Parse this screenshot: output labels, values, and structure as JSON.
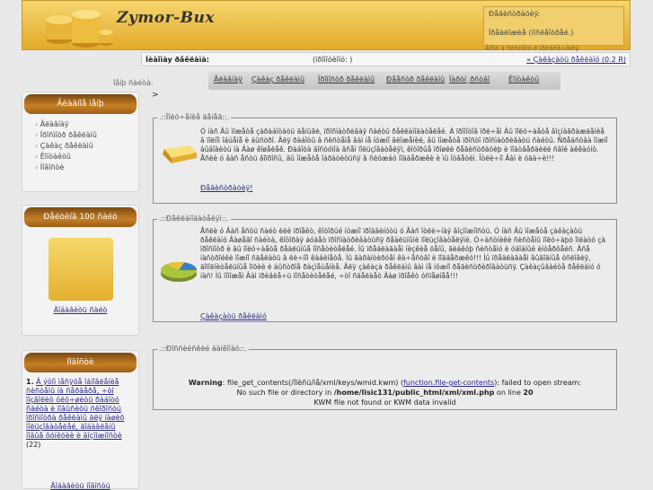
{
  "header": {
    "logo": "Zymor-Bux",
    "register_title": "Ðåãèñòðàöèÿ:",
    "register_line2": "Ïðåäëîæèå (ïîñëåîòðåé.)",
    "register_sub": "Âõîä â ñèñòåìó è ïðèâëå÷åíèÿ"
  },
  "infobar": {
    "label": "Íèàîìày ðåêëàìà:",
    "middle": "(ïðîìîòèîíó: )",
    "right_link": "» Çàêàçàòü ðåêëàìó (0.2 R)"
  },
  "topnav": {
    "label": "Ìåíþ ñàéòà:",
    "items": [
      "Ãëàâíàÿ",
      "Çàêàç ðåêëàìû",
      "Ïðîìîñòð ðåêëàìû",
      "Ðååñòð ðåêëàìû",
      "Ïàðòí¸ðñòâî",
      "Êîíòàêòû"
    ],
    "arrow": ">"
  },
  "menu": {
    "title": "Ãëàâíîå ìåíþ",
    "items": [
      "Ãëàâíàÿ",
      "Ïðîñìîòð ðåêëàìû",
      "Çàêàç ðåêëàìû",
      "Êîíòàêòû",
      "Íîâîñòè"
    ]
  },
  "top100": {
    "title": "Ðåéòèíã 100 ñàéò",
    "link": "Äîáàâèòü ñàéò"
  },
  "news": {
    "title": "Íîâîñòè",
    "item_num": "1.",
    "item_text": "Â ýòîì ìåñÿöå îáíîâëåíèå ñèñòåìû íà ñåðâåðå, ÷òî ïîçâîëèò óëó÷øèòü ðàáîòó ñàéòà è ïîâûñèòü ñêîðîñòü ïðîñìîòðà ðåêëàìû äëÿ íàøèõ ïîëüçîâàòåëåé, äîáàâëåíû íîâûå ôóíêöèè è âîçìîæíîñòè",
    "item_count": "(22)",
    "more": "Äîáàâèòü íîâîñòü"
  },
  "section1": {
    "legend": ".::Ïîëó÷åíèå äåíåã::.",
    "text": "Ó íàñ Âû ìîæåòå çàðàáîòàòü äåíüãè, ïðîñìàòðèâàÿ ñàéòû ðåêëàìîäàòåëåé. À ïðîìîòîâ ïðè÷åì Âû ïîëó÷àåòå âîçíàãðàæäåíèå â ïîëíîì îáúåìå è áûñòðî. Äëÿ ðàáîòû â ñèñòåìå âàì íå íóæíî âëîæåíèé, âû ìîæåòå ïðîñòî ïðîñìàòðèâàòü ñàéòû. Ñðåäñòâà ìîæíî âûâîäèòü íà Âàø êîøåëåê. Ðàáîòà äîñòóïíà âñåì ïîëüçîâàòåëÿì, êîòîðûå ïðîøëè ðåãèñòðàöèþ è ïîäòâåðäèëè ñâîé àêêàóíò. Åñëè ó âàñ åñòü âîïðîñû, âû ìîæåòå îáðàòèòüñÿ â ñëóæáó ïîääåðæêè è ìû îòâåòèì. Îòëè÷íî Âàì è óäà÷è!!!",
    "link": "Ðåãèñòðàöèÿ!"
  },
  "section2": {
    "legend": ".::Ðåêëàìîäàòåëÿì::.",
    "text": "Åñëè ó Âàñ åñòü ñàéò èëè ïðîåêò, êîòîðûé íóæíî ïðîäâèíóòü ó Âàñ îòëè÷íàÿ âîçìîæíîñòü. Ó íàñ Âû ìîæåòå çàêàçàòü ðåêëàìó Âàøåãî ñàéòà, êîòîðàÿ áóäåò ïðîñìàòðèâàòüñÿ ðåàëüíûìè ïîëüçîâàòåëÿìè. Ó÷àñòíèêè ñèñòåìû ïîëó÷àþò îïëàòó çà ïðîñìîòð è âû ïîëó÷àåòå ðåàëüíûå ïîñåòèòåëåé. Ìû ïðåäëàãàåì íèçêèå öåíû, ãèáêóþ ñèñòåìó è óäîáíûé èíòåðôåéñ. Âñå íàñòðîéêè ìîæíî ñäåëàòü â ëè÷íîì êàáèíåòå. Ìû ãàðàíòèðóåì êà÷åñòâî è ïîääåðæêó!!! Ìû ïðåäëàãàåì âûãîäíûå óñëîâèÿ, äîïîëíèòåëüíûå îïöèè è áûñòðîå ðàçìåùåíèå. Äëÿ çàêàçà ðåêëàìû âàì íå íóæíî ðåãèñòðèðîâàòüñÿ. Çàêàçûâàéòå ðåêëàìó ó íàñ! Ìû ïîìîæåì Âàì ïðèâëå÷ü ïîñåòèòåëåé, ÷òî ñäåëàåò Âàø ïðîåêò óñïåøíåå!!!",
    "link": "Çàêàçàòü ðåêëàìó"
  },
  "section3": {
    "legend": ".::Ðîññèéñêèé áàíêîìàò::.",
    "warning_label": "Warning",
    "warning_text": ": file_get_contents(/îïèñü/ìå/xml/keys/wmid.kwm) (",
    "warning_link": "function.file-get-contents",
    "warning_tail": "): failed to open stream:",
    "line2_a": "No such file or directory in ",
    "line2_path": "/home/lisic131/public_html/xml/xml.php",
    "line2_b": " on line ",
    "line2_num": "20",
    "line3": "KWM file not found or KWM data invalid"
  },
  "colors": {
    "header_gold": "#e8b93c",
    "menu_head_brown": "#b06d1e",
    "link_blue": "#2a2a8a"
  }
}
